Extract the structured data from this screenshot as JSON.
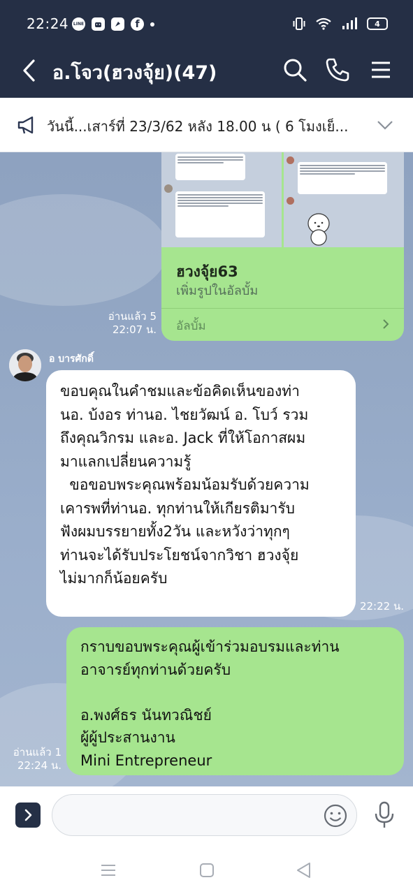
{
  "status_bar": {
    "time": "22:24",
    "app_icons": [
      "line-icon",
      "android-app-icon",
      "pinterest-like-icon",
      "facebook-icon"
    ],
    "battery": "4"
  },
  "header": {
    "title": "อ.โจว(ฮวงจุ้ย)(47)",
    "bg_color": "#252f45"
  },
  "announcement": {
    "text": "วันนี้...เสาร์ที่ 23/3/62  หลัง 18.00 น ( 6 โมงเย็..."
  },
  "album_message": {
    "album_name": "ฮวงจุ้ย63",
    "subtitle": "เพิ่มรูปในอัลบั้ม",
    "footer_label": "อัลบั้ม",
    "read_status": "อ่านแล้ว 5",
    "time": "22:07 น."
  },
  "incoming_message": {
    "sender": "อ บารศักดิ์",
    "text": "ขอบคุณในคำชมและข้อคิดเห็นของท่า\nนอ. บ้งอร ท่านอ. ไชยวัฒน์ อ. โบว์ รวม\nถึงคุณวิกรม และอ. Jack ที่ให้โอกาสผม\nมาแลกเปลี่ยนความรู้\n  ขอขอบพระคุณพร้อมน้อมรับด้วยความ\nเคารพที่ท่านอ. ทุกท่านให้เกียรติมารับ\nฟังผมบรรยายทั้ง2วัน และหวังว่าทุกๆ\nท่านจะได้รับประโยชน์จากวิชา ฮวงจุ้ย\nไม่มากก็น้อยครับ",
    "time": "22:22 น."
  },
  "outgoing_message": {
    "text": "กราบขอบพระคุณผู้เข้าร่วมอบรมและท่าน\nอาจารย์ทุกท่านด้วยครับ\n\nอ.พงศ์ธร นันทวณิชย์\nผู้ผู้ประสานงาน\nMini Entrepreneur",
    "read_status": "อ่านแล้ว 1",
    "time": "22:24 น.",
    "bubble_color": "#a6e58f"
  },
  "input": {
    "placeholder": ""
  }
}
